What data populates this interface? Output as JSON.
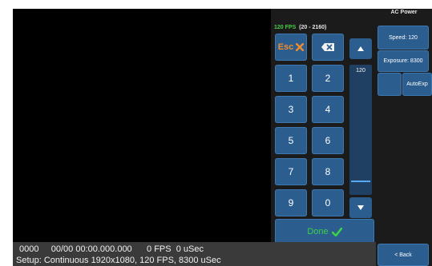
{
  "keypad": {
    "fps_value": "120 FPS",
    "fps_range": "(20 - 2160)",
    "esc_label": "Esc",
    "keys": [
      "1",
      "2",
      "3",
      "4",
      "5",
      "6",
      "7",
      "8",
      "9",
      "0"
    ],
    "done_label": "Done",
    "scroll_value": "120",
    "scroll_position": 0.9
  },
  "right_panel": {
    "title": "AC Power",
    "speed": "Speed: 120",
    "exposure": "Exposure: 8300",
    "autoexp": "AutoExp",
    "back": "< Back"
  },
  "status": {
    "line1": "0000     00/00 00:00.000.000      0 FPS  0 uSec",
    "line2": "Setup: Continuous 1920x1080, 120 FPS, 8300 uSec"
  },
  "colors": {
    "key_blue": "#2b5d8f",
    "fps_green": "#46d046",
    "esc_orange": "#f08c2c",
    "done_green": "#3bd14a"
  }
}
